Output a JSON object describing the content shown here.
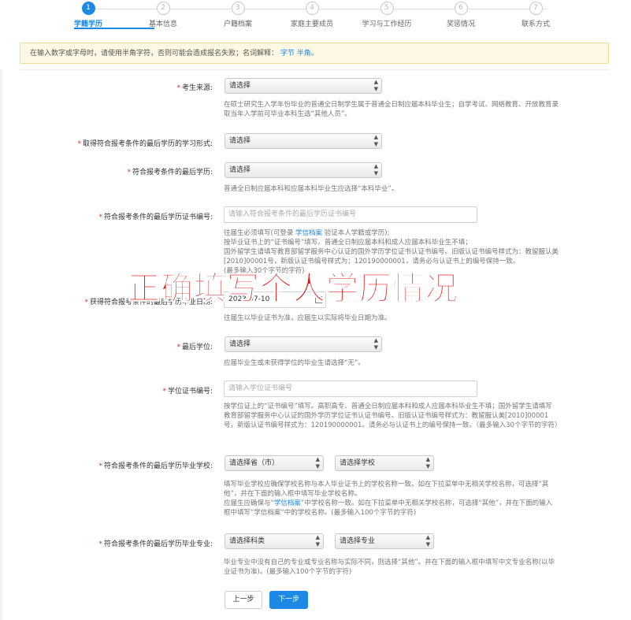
{
  "steps": [
    {
      "num": "1",
      "label": "学籍学历"
    },
    {
      "num": "2",
      "label": "基本信息"
    },
    {
      "num": "3",
      "label": "户籍档案"
    },
    {
      "num": "4",
      "label": "家庭主要成员"
    },
    {
      "num": "5",
      "label": "学习与工作经历"
    },
    {
      "num": "6",
      "label": "奖惩情况"
    },
    {
      "num": "7",
      "label": "联系方式"
    }
  ],
  "notice": {
    "text": "在输入数字或字母时，请使用半角字符，否则可能会造成报名失败；名词解释：",
    "term1": "字节",
    "term2": "半角。"
  },
  "fields": {
    "source": {
      "label": "考生来源:",
      "value": "请选择",
      "help": "在硕士研究生入学年份毕业的普通全日制学生属于普通全日制应届本科毕业生；自学考试、网络教育、开放教育录取当年入学前可毕业本科生选“其他人员”。"
    },
    "study_form": {
      "label": "取得符合报考条件的最后学历的学习形式:",
      "value": "请选择"
    },
    "last_degree_level": {
      "label": "符合报考条件的最后学历:",
      "value": "请选择",
      "help": "普通全日制应届本科和应届本科毕业生应选择“本科毕业”。"
    },
    "certificate_no": {
      "label": "符合报考条件的最后学历证书编号:",
      "placeholder": "请输入符合报考条件的最后学历证书编号",
      "help_prefix": "往届生必须填写(可登录",
      "help_link": "学信档案",
      "help_suffix": "验证本人学籍或学历);",
      "help_line2": "按毕业证书上的“证书编号”填写。普通全日制应届本科和成人应届本科毕业生不填；",
      "help_line3": "国外留学生请填写教育部留学服务中心认证的国外学历学位证书认证书编号。旧版认证书编号样式为：教留服认美[2010]00001号，新版认证书编号样式为：120190000001，请务必与认证书上的编号保持一致。",
      "help_line4": "(最多输入30个字节的字符)"
    },
    "grad_date": {
      "label": "获得符合报考条件的最后学历毕业日期:",
      "value": "2023-07-10",
      "help": "往届生以毕业证书为准，应届生以实际将毕业日期为准。"
    },
    "degree": {
      "label": "最后学位:",
      "value": "请选择",
      "help": "应届毕业生或未获得学位的毕业生请选择“无”。"
    },
    "degree_cert": {
      "label": "学位证书编号:",
      "placeholder": "请输入学位证书编号",
      "help": "按学位证上的“证书编号”填写。高职高专、普通全日制应届本科和成人应届本科毕业生不填；国外留学生请填写教育部留学服务中心认证的国外学历学位证书认证书编号。旧版认证书编号样式为：教留服认美[2010]00001号，新版认证书编号样式为：120190000001。请务必与认证书上的编号保持一致。（最多输入30个字节的字符）"
    },
    "school": {
      "label": "符合报考条件的最后学历毕业学校:",
      "province": "请选择省（市）",
      "school": "请选择学校",
      "help_line1": "填写毕业学校应确保学校名称与本人毕业证书上的学校名称一致。如在下拉菜单中无相关学校名称，可选择“其他”，并在下面的输入框中填写毕业学校名称。",
      "help_line2_prefix": "应届生应确保与“",
      "help_link": "学信档案",
      "help_line2_suffix": "”中学校名称一致。如在下拉菜单中无相关学校名称，可选择“其他”，并在下面的输入框中填写“学信档案”中的学校名称。(最多输入100个字节的字符)"
    },
    "major": {
      "label": "符合报考条件的最后学历毕业专业:",
      "category": "请选择科类",
      "major": "请选择专业",
      "help": "毕业专业中没有自己的专业或专业名称与实际不同，则选择“其他”。并在下面的输入框中填写中文专业名称(以毕业证书为准)。(最多输入100个字节的字符)"
    }
  },
  "buttons": {
    "prev": "上一步",
    "next": "下一步"
  },
  "overlay_text": "正确填写个人学历情况",
  "colors": {
    "accent": "#1e88e5",
    "required": "#d9322a",
    "overlay": "#e8100e",
    "notice_bg": "#fcf8e3"
  }
}
